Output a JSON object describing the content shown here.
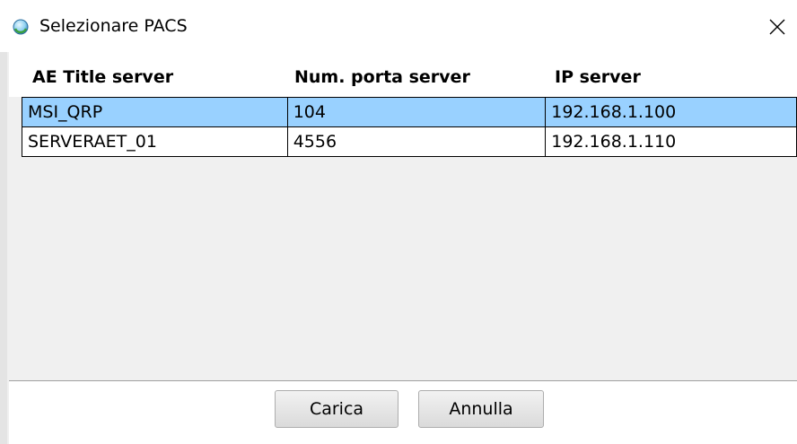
{
  "window": {
    "title": "Selezionare PACS",
    "icon": "app-icon",
    "close_icon": "close-icon"
  },
  "grid": {
    "columns": [
      "AE Title server",
      "Num. porta server",
      "IP server"
    ],
    "rows": [
      {
        "ae_title": "MSI_QRP",
        "port": "104",
        "ip": "192.168.1.100",
        "selected": true
      },
      {
        "ae_title": "SERVERAET_01",
        "port": "4556",
        "ip": "192.168.1.110",
        "selected": false
      }
    ],
    "selection_color": "#99d1ff"
  },
  "buttons": {
    "load_label": "Carica",
    "cancel_label": "Annulla"
  }
}
